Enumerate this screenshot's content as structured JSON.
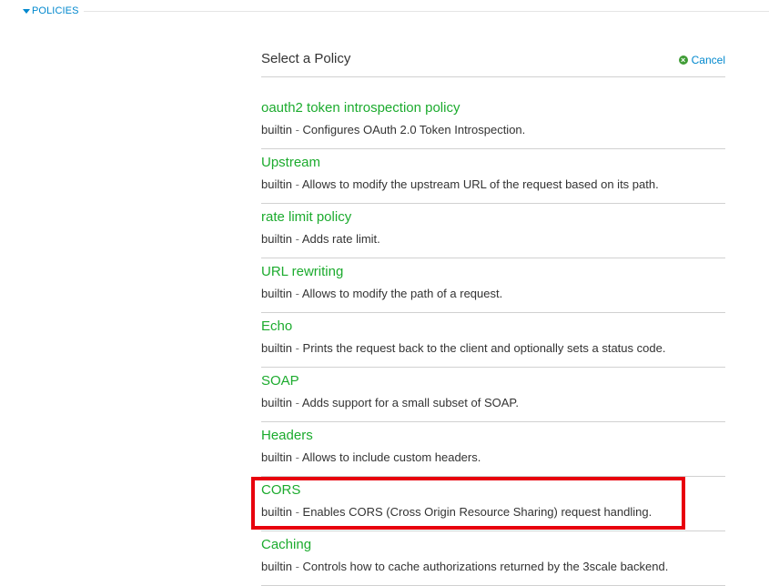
{
  "section": {
    "label": "POLICIES"
  },
  "panel": {
    "title": "Select a Policy",
    "cancel_label": "Cancel"
  },
  "policies": [
    {
      "name": "oauth2 token introspection policy",
      "source": "builtin",
      "separator": " - ",
      "description": "Configures OAuth 2.0 Token Introspection."
    },
    {
      "name": "Upstream",
      "source": "builtin",
      "separator": " - ",
      "description": "Allows to modify the upstream URL of the request based on its path."
    },
    {
      "name": "rate limit policy",
      "source": "builtin",
      "separator": " - ",
      "description": "Adds rate limit."
    },
    {
      "name": "URL rewriting",
      "source": "builtin",
      "separator": " - ",
      "description": "Allows to modify the path of a request."
    },
    {
      "name": "Echo",
      "source": "builtin",
      "separator": " - ",
      "description": "Prints the request back to the client and optionally sets a status code."
    },
    {
      "name": "SOAP",
      "source": "builtin",
      "separator": " - ",
      "description": "Adds support for a small subset of SOAP."
    },
    {
      "name": "Headers",
      "source": "builtin",
      "separator": " - ",
      "description": "Allows to include custom headers."
    },
    {
      "name": "CORS",
      "source": "builtin",
      "separator": " - ",
      "description": "Enables CORS (Cross Origin Resource Sharing) request handling."
    },
    {
      "name": "Caching",
      "source": "builtin",
      "separator": " - ",
      "description": "Controls how to cache authorizations returned by the 3scale backend."
    }
  ],
  "colors": {
    "link_blue": "#0088ce",
    "policy_green": "#1cab2e",
    "highlight_red": "#e8000d",
    "cancel_icon_green": "#3f9c35"
  },
  "icons": {
    "section_toggle": "caret-down-icon",
    "cancel": "times-circle-icon"
  }
}
